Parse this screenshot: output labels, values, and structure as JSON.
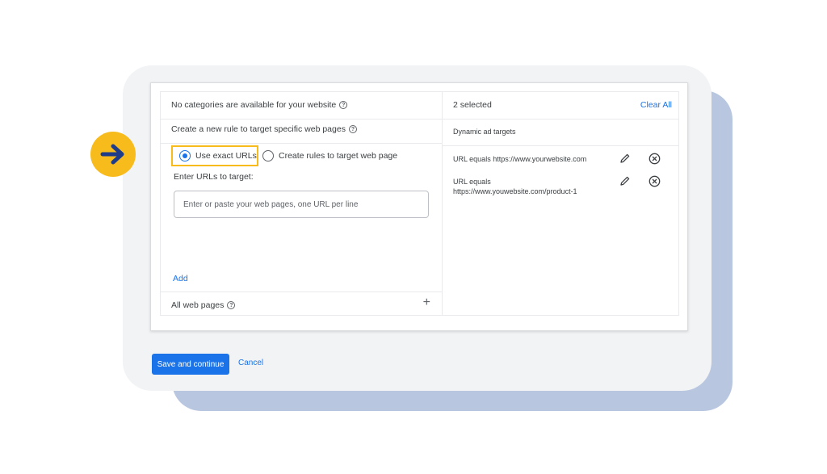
{
  "categories_panel": {
    "no_categories_text": "No categories are available for your website",
    "create_rule_text": "Create a new rule to target specific web pages",
    "radio_exact": "Use exact URLs",
    "radio_rules": "Create rules to target web page",
    "enter_urls_label": "Enter URLs to target:",
    "url_placeholder": "Enter or paste your web pages, one URL per line",
    "add_link": "Add",
    "all_web_pages": "All web pages"
  },
  "selected_panel": {
    "count_text": "2 selected",
    "clear_all": "Clear All",
    "section_title": "Dynamic ad targets",
    "targets": [
      {
        "label": "URL equals https://www.yourwebsite.com"
      },
      {
        "label_line1": "URL equals",
        "label_line2": "https://www.youwebsite.com/product-1"
      }
    ]
  },
  "footer": {
    "save_button": "Save and continue",
    "cancel_button": "Cancel"
  },
  "colors": {
    "accent": "#1a73e8",
    "highlight": "#f7bb1c",
    "arrow": "#1f3c88"
  },
  "icons": [
    "arrow-right-icon",
    "help-icon",
    "edit-icon",
    "remove-icon",
    "plus-icon"
  ]
}
